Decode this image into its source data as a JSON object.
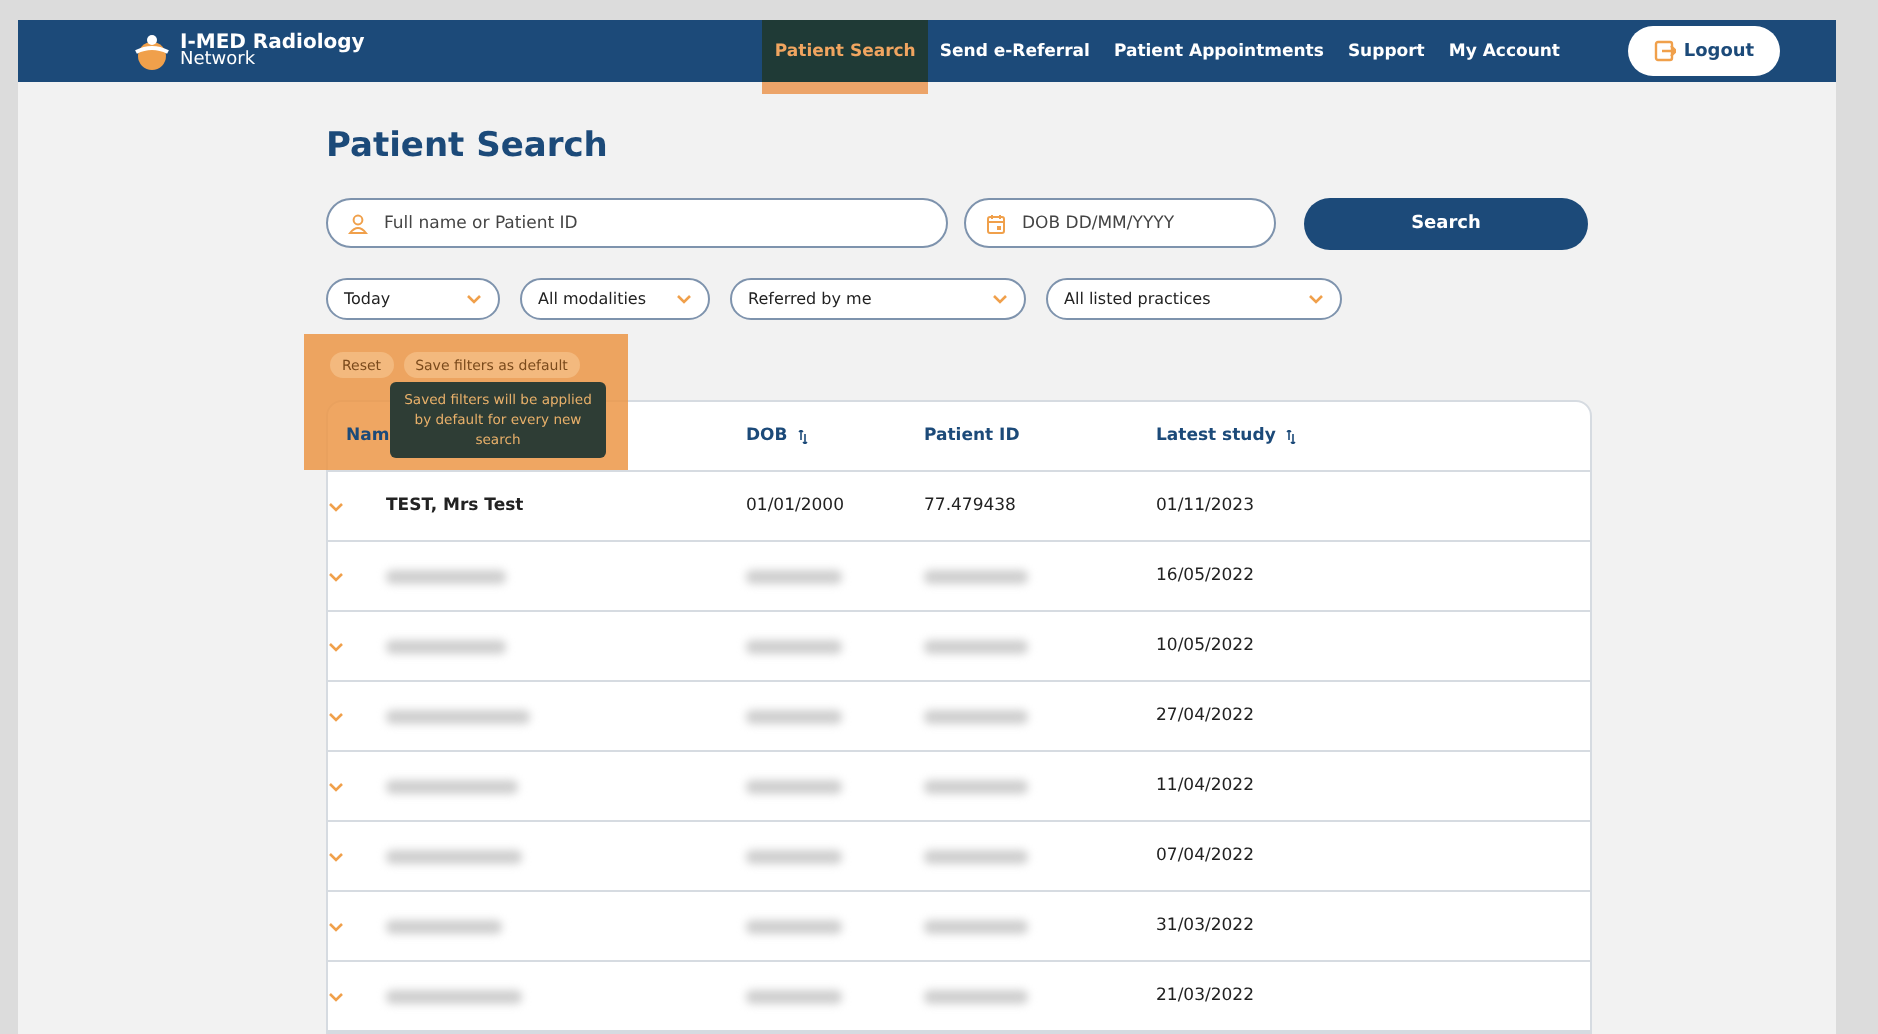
{
  "header": {
    "logo": {
      "line1": "I-MED Radiology",
      "line2": "Network"
    },
    "nav": [
      {
        "label": "Patient Search",
        "selected": true,
        "highlighted": true
      },
      {
        "label": "Send e-Referral",
        "selected": false,
        "highlighted": false
      },
      {
        "label": "Patient Appointments",
        "selected": false,
        "highlighted": false
      },
      {
        "label": "Support",
        "selected": false,
        "highlighted": false
      },
      {
        "label": "My Account",
        "selected": false,
        "highlighted": false
      }
    ],
    "logout": "Logout"
  },
  "title": "Patient Search",
  "search": {
    "name_placeholder": "Full name or Patient ID",
    "dob_placeholder": "DOB DD/MM/YYYY",
    "button": "Search"
  },
  "filters": [
    "Today",
    "All modalities",
    "Referred by me",
    "All listed practices"
  ],
  "filter_actions": {
    "highlighted": true,
    "buttons": [
      "Reset",
      "Save filters as default"
    ],
    "tooltip": "Saved filters will be applied by default for every new search"
  },
  "table": {
    "columns": [
      {
        "label": "Nam",
        "sortable": false
      },
      {
        "label": "DOB",
        "sortable": true
      },
      {
        "label": "Patient ID",
        "sortable": false
      },
      {
        "label": "Latest study",
        "sortable": true
      }
    ],
    "rows": [
      {
        "redacted": false,
        "name": "TEST, Mrs Test",
        "dob": "01/01/2000",
        "patient_id": "77.479438",
        "latest": "01/11/2023"
      },
      {
        "redacted": true,
        "latest": "16/05/2022"
      },
      {
        "redacted": true,
        "latest": "10/05/2022"
      },
      {
        "redacted": true,
        "latest": "27/04/2022"
      },
      {
        "redacted": true,
        "latest": "11/04/2022"
      },
      {
        "redacted": true,
        "latest": "07/04/2022"
      },
      {
        "redacted": true,
        "latest": "31/03/2022"
      },
      {
        "redacted": true,
        "latest": "21/03/2022"
      }
    ]
  }
}
